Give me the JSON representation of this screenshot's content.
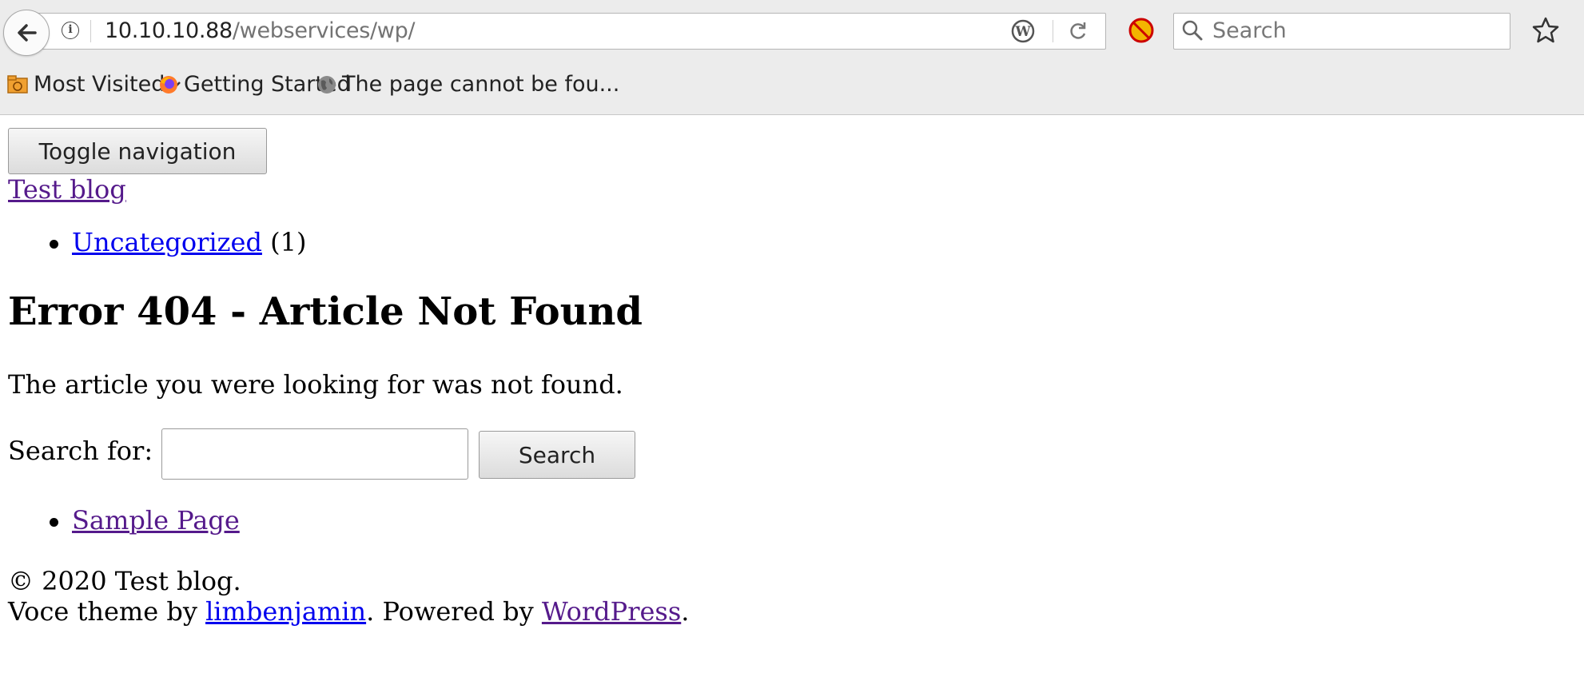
{
  "browser": {
    "url_host": "10.10.10.88",
    "url_path": "/webservices/wp/",
    "search_placeholder": "Search",
    "bookmarks": [
      {
        "label": "Most Visited",
        "icon": "folder-icon"
      },
      {
        "label": "Getting Started",
        "icon": "firefox-icon"
      },
      {
        "label": "The page cannot be fou...",
        "icon": "globe-icon"
      }
    ]
  },
  "page": {
    "toggle_label": "Toggle navigation",
    "site_title": "Test blog",
    "categories": [
      {
        "label": "Uncategorized",
        "count": "(1)"
      }
    ],
    "heading": "Error 404 - Article Not Found",
    "message": "The article you were looking for was not found.",
    "search_label": "Search for:",
    "search_button": "Search",
    "pages": [
      {
        "label": "Sample Page"
      }
    ],
    "footer": {
      "copyright": "© 2020 Test blog.",
      "theme_prefix": "Voce theme by ",
      "theme_author": "limbenjamin",
      "powered_prefix": ". Powered by ",
      "powered_link": "WordPress",
      "end": "."
    }
  }
}
